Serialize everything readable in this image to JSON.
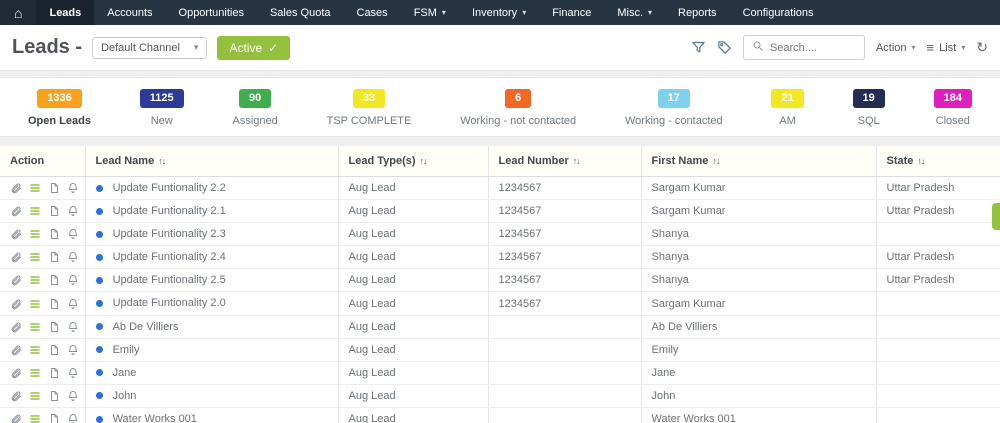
{
  "nav": {
    "items": [
      {
        "label": "Leads",
        "active": true,
        "dropdown": false
      },
      {
        "label": "Accounts",
        "active": false,
        "dropdown": false
      },
      {
        "label": "Opportunities",
        "active": false,
        "dropdown": false
      },
      {
        "label": "Sales Quota",
        "active": false,
        "dropdown": false
      },
      {
        "label": "Cases",
        "active": false,
        "dropdown": false
      },
      {
        "label": "FSM",
        "active": false,
        "dropdown": true
      },
      {
        "label": "Inventory",
        "active": false,
        "dropdown": true
      },
      {
        "label": "Finance",
        "active": false,
        "dropdown": false
      },
      {
        "label": "Misc.",
        "active": false,
        "dropdown": true
      },
      {
        "label": "Reports",
        "active": false,
        "dropdown": false
      },
      {
        "label": "Configurations",
        "active": false,
        "dropdown": false
      }
    ]
  },
  "header": {
    "title": "Leads -",
    "channel_select": "Default Channel",
    "active_label": "Active",
    "active_check": "✓",
    "search_placeholder": "Search....",
    "action_label": "Action",
    "list_label": "List"
  },
  "colors": {
    "accent_green": "#94c13d",
    "lead_dot_blue": "#2a6fdb"
  },
  "stats": [
    {
      "count": "1336",
      "label": "Open Leads",
      "color": "#f9a11b"
    },
    {
      "count": "1125",
      "label": "New",
      "color": "#2e3a97"
    },
    {
      "count": "90",
      "label": "Assigned",
      "color": "#3fae4c"
    },
    {
      "count": "33",
      "label": "TSP COMPLETE",
      "color": "#f2e821"
    },
    {
      "count": "6",
      "label": "Working - not contacted",
      "color": "#f26722"
    },
    {
      "count": "17",
      "label": "Working - contacted",
      "color": "#7ed0ee"
    },
    {
      "count": "21",
      "label": "AM",
      "color": "#f2e821"
    },
    {
      "count": "19",
      "label": "SQL",
      "color": "#232e52"
    },
    {
      "count": "184",
      "label": "Closed",
      "color": "#e01ec0"
    }
  ],
  "table": {
    "columns": [
      {
        "label": "Action",
        "sortable": false
      },
      {
        "label": "Lead Name",
        "sortable": true
      },
      {
        "label": "Lead Type(s)",
        "sortable": true
      },
      {
        "label": "Lead Number",
        "sortable": true
      },
      {
        "label": "First Name",
        "sortable": true
      },
      {
        "label": "State",
        "sortable": true
      }
    ],
    "rows": [
      {
        "lead_name": "Update Funtionality 2.2",
        "lead_type": "Aug Lead",
        "lead_number": "1234567",
        "first_name": "Sargam Kumar",
        "state": "Uttar Pradesh"
      },
      {
        "lead_name": "Update Funtionality 2.1",
        "lead_type": "Aug Lead",
        "lead_number": "1234567",
        "first_name": "Sargam Kumar",
        "state": "Uttar Pradesh"
      },
      {
        "lead_name": "Update Funtionality 2.3",
        "lead_type": "Aug Lead",
        "lead_number": "1234567",
        "first_name": "Shanya",
        "state": ""
      },
      {
        "lead_name": "Update Funtionality 2.4",
        "lead_type": "Aug Lead",
        "lead_number": "1234567",
        "first_name": "Shanya",
        "state": "Uttar Pradesh"
      },
      {
        "lead_name": "Update Funtionality 2.5",
        "lead_type": "Aug Lead",
        "lead_number": "1234567",
        "first_name": "Shanya",
        "state": "Uttar Pradesh"
      },
      {
        "lead_name": "Update Funtionality 2.0",
        "lead_type": "Aug Lead",
        "lead_number": "1234567",
        "first_name": "Sargam Kumar",
        "state": ""
      },
      {
        "lead_name": "Ab De Villiers",
        "lead_type": "Aug Lead",
        "lead_number": "",
        "first_name": "Ab De Villiers",
        "state": ""
      },
      {
        "lead_name": "Emily",
        "lead_type": "Aug Lead",
        "lead_number": "",
        "first_name": "Emily",
        "state": ""
      },
      {
        "lead_name": "Jane",
        "lead_type": "Aug Lead",
        "lead_number": "",
        "first_name": "Jane",
        "state": ""
      },
      {
        "lead_name": "John",
        "lead_type": "Aug Lead",
        "lead_number": "",
        "first_name": "John",
        "state": ""
      },
      {
        "lead_name": "Water Works 001",
        "lead_type": "Aug Lead",
        "lead_number": "",
        "first_name": "Water Works 001",
        "state": ""
      }
    ]
  }
}
